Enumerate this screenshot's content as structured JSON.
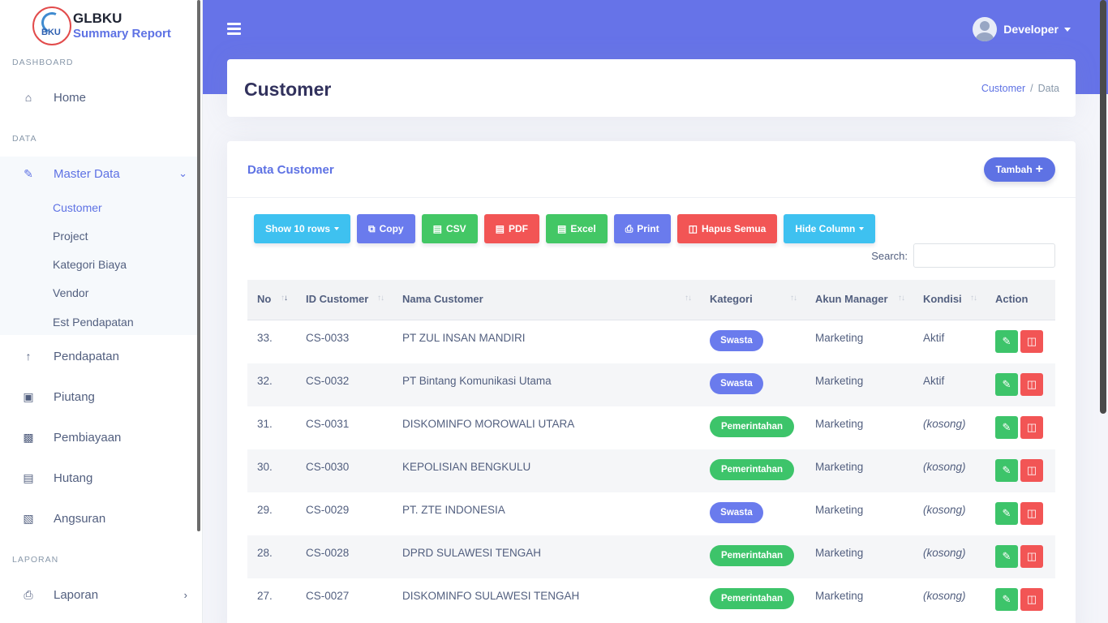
{
  "brand": {
    "title": "GLBKU",
    "subtitle": "Summary Report",
    "logo_text": "BKU"
  },
  "sidebar": {
    "headings": {
      "dashboard": "DASHBOARD",
      "data": "DATA",
      "laporan": "LAPORAN"
    },
    "home": "Home",
    "master_data": "Master Data",
    "sub_items": [
      "Customer",
      "Project",
      "Kategori Biaya",
      "Vendor",
      "Est Pendapatan"
    ],
    "items": [
      "Pendapatan",
      "Piutang",
      "Pembiayaan",
      "Hutang",
      "Angsuran"
    ],
    "laporan": "Laporan"
  },
  "header": {
    "user": "Developer"
  },
  "page": {
    "title": "Customer",
    "breadcrumb": [
      "Customer",
      "Data"
    ]
  },
  "card": {
    "title": "Data Customer",
    "add_button": "Tambah"
  },
  "toolbar": {
    "show_rows": "Show 10 rows",
    "copy": "Copy",
    "csv": "CSV",
    "pdf": "PDF",
    "excel": "Excel",
    "print": "Print",
    "hapus": "Hapus Semua",
    "hide": "Hide Column"
  },
  "search": {
    "label": "Search:",
    "value": ""
  },
  "table": {
    "columns": [
      "No",
      "ID Customer",
      "Nama Customer",
      "Kategori",
      "Akun Manager",
      "Kondisi",
      "Action"
    ],
    "rows": [
      {
        "no": "33.",
        "id": "CS-0033",
        "nama": "PT ZUL INSAN MANDIRI",
        "kategori": "Swasta",
        "akun": "Marketing",
        "kondisi": "Aktif"
      },
      {
        "no": "32.",
        "id": "CS-0032",
        "nama": "PT Bintang Komunikasi Utama",
        "kategori": "Swasta",
        "akun": "Marketing",
        "kondisi": "Aktif"
      },
      {
        "no": "31.",
        "id": "CS-0031",
        "nama": "DISKOMINFO MOROWALI UTARA",
        "kategori": "Pemerintahan",
        "akun": "Marketing",
        "kondisi": "(kosong)"
      },
      {
        "no": "30.",
        "id": "CS-0030",
        "nama": "KEPOLISIAN BENGKULU",
        "kategori": "Pemerintahan",
        "akun": "Marketing",
        "kondisi": "(kosong)"
      },
      {
        "no": "29.",
        "id": "CS-0029",
        "nama": "PT. ZTE INDONESIA",
        "kategori": "Swasta",
        "akun": "Marketing",
        "kondisi": "(kosong)"
      },
      {
        "no": "28.",
        "id": "CS-0028",
        "nama": "DPRD SULAWESI TENGAH",
        "kategori": "Pemerintahan",
        "akun": "Marketing",
        "kondisi": "(kosong)"
      },
      {
        "no": "27.",
        "id": "CS-0027",
        "nama": "DISKOMINFO SULAWESI TENGAH",
        "kategori": "Pemerintahan",
        "akun": "Marketing",
        "kondisi": "(kosong)"
      }
    ]
  },
  "colors": {
    "primary": "#5e72e4",
    "header": "#6673e8",
    "success": "#3dc46a",
    "danger": "#f25555",
    "info": "#3ec1f0"
  }
}
